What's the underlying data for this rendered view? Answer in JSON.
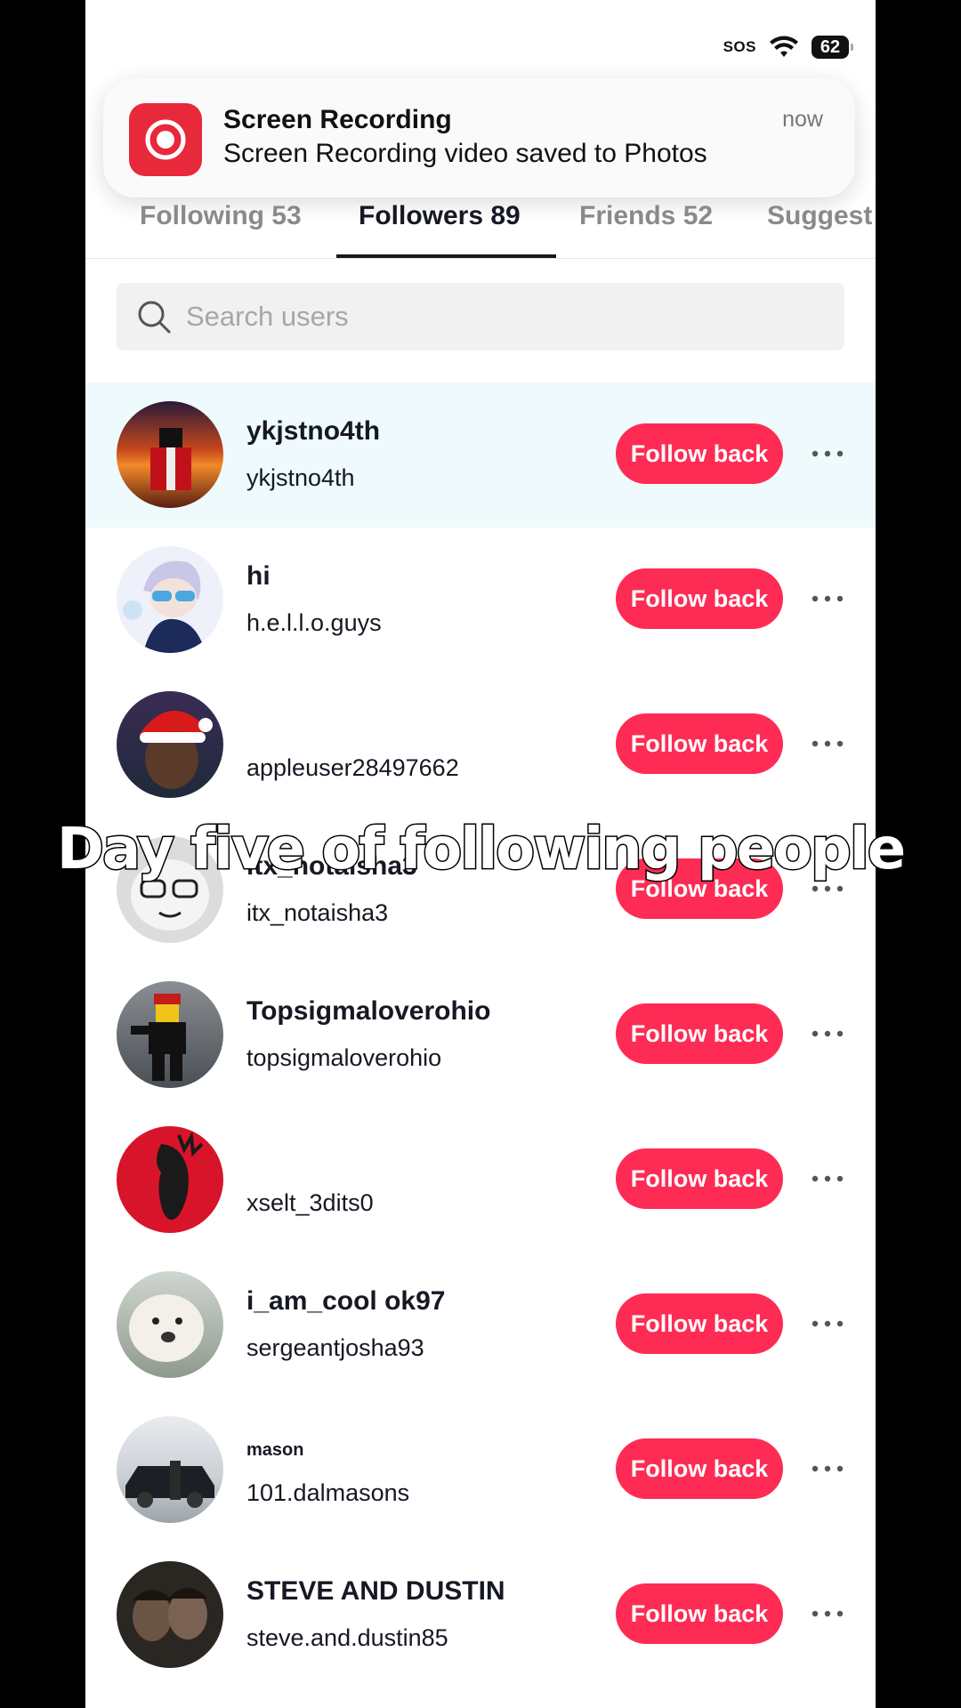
{
  "status_bar": {
    "sos": "SOS",
    "battery": "62"
  },
  "notification": {
    "title": "Screen Recording",
    "body": "Screen Recording video saved to Photos",
    "time": "now"
  },
  "tabs": [
    {
      "label": "Following 53"
    },
    {
      "label": "Followers 89",
      "active": true
    },
    {
      "label": "Friends 52"
    },
    {
      "label": "Suggest"
    }
  ],
  "search": {
    "placeholder": "Search users"
  },
  "follow_label": "Follow back",
  "users": [
    {
      "name": "ykjstno4th",
      "handle": "ykjstno4th"
    },
    {
      "name": "hi",
      "handle": "h.e.l.l.o.guys"
    },
    {
      "name": "",
      "handle": "appleuser28497662"
    },
    {
      "name": "itx_notaisha3",
      "handle": "itx_notaisha3"
    },
    {
      "name": "Topsigmaloverohio",
      "handle": "topsigmaloverohio"
    },
    {
      "name": "",
      "handle": "xselt_3dits0"
    },
    {
      "name": "i_am_cool ok97",
      "handle": "sergeantjosha93"
    },
    {
      "name": "mason",
      "handle": "101.dalmasons"
    },
    {
      "name": "STEVE AND DUSTIN",
      "handle": "steve.and.dustin85"
    }
  ],
  "caption": "Day five of following people",
  "colors": {
    "follow_button": "#fe2c55",
    "highlight_row": "#eefafc",
    "recording_icon": "#e8283b"
  }
}
